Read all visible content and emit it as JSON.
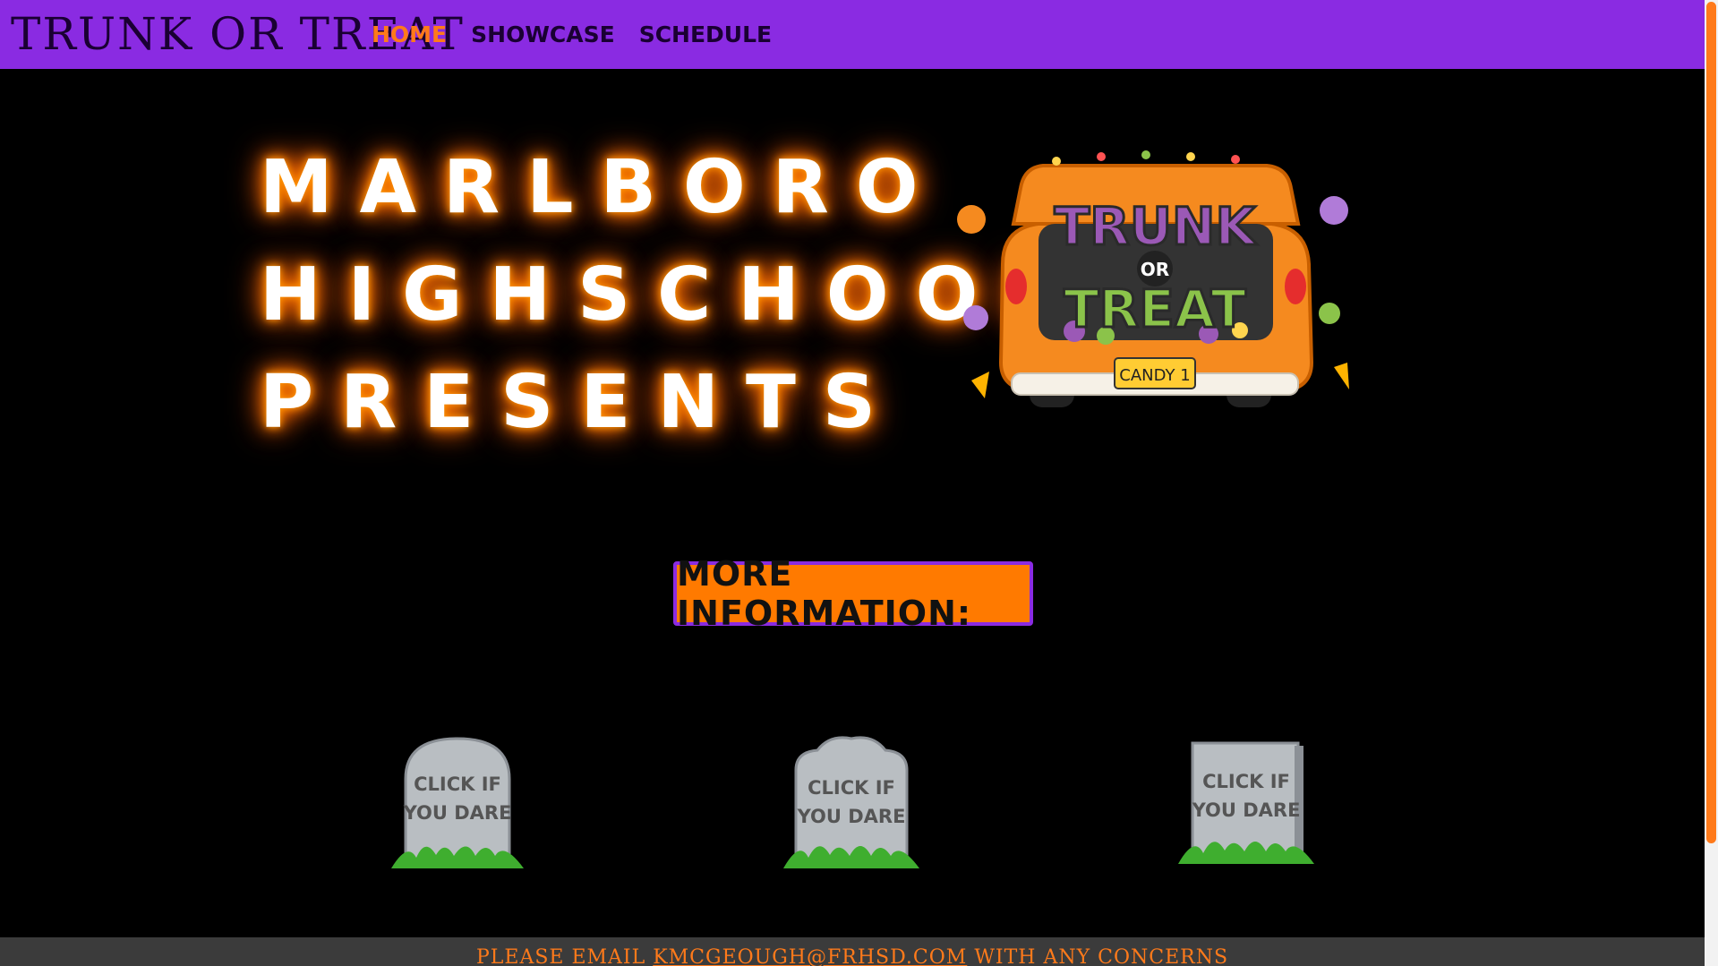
{
  "nav": {
    "brand": "TRUNK OR TREAT",
    "items": [
      {
        "label": "HOME",
        "active": true
      },
      {
        "label": "SHOWCASE",
        "active": false
      },
      {
        "label": "SCHEDULE",
        "active": false
      }
    ]
  },
  "hero": {
    "lines": [
      "MARLBORO",
      "HIGHSCHOOL",
      "PRESENTS"
    ]
  },
  "logo": {
    "top_word": "TRUNK",
    "middle_word": "OR",
    "bottom_word": "TREAT",
    "plate": "CANDY 1"
  },
  "info_button": {
    "label": "MORE INFORMATION:"
  },
  "tombstones": [
    {
      "line1": "CLICK IF",
      "line2": "YOU DARE"
    },
    {
      "line1": "CLICK IF",
      "line2": "YOU DARE"
    },
    {
      "line1": "CLICK IF",
      "line2": "YOU DARE"
    }
  ],
  "footer": {
    "prefix": "PLEASE EMAIL ",
    "email": "KMCGEOUGH@FRHSD.COM",
    "suffix": " WITH ANY CONCERNS"
  },
  "colors": {
    "nav_bg": "#8a2be2",
    "accent_orange": "#ff7a1a",
    "footer_bg": "#3b3b3b"
  }
}
